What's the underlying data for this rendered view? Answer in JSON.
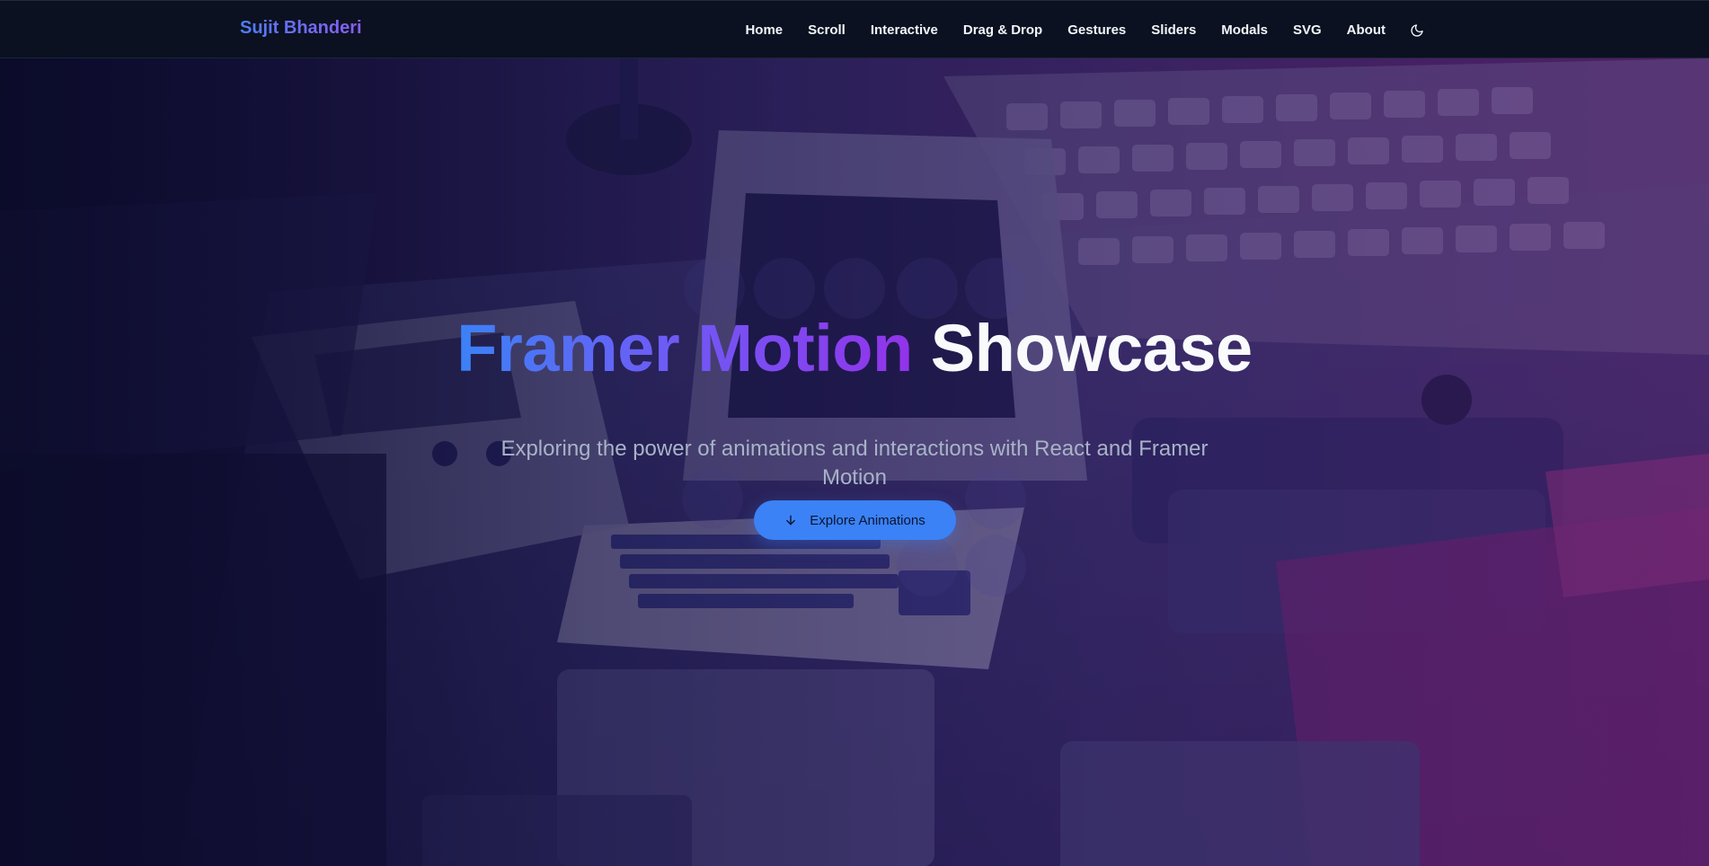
{
  "header": {
    "brand": "Sujit Bhanderi",
    "nav": [
      "Home",
      "Scroll",
      "Interactive",
      "Drag & Drop",
      "Gestures",
      "Sliders",
      "Modals",
      "SVG",
      "About"
    ],
    "theme_icon": "moon-icon"
  },
  "hero": {
    "title_gradient": "Framer Motion",
    "title_plain": "Showcase",
    "subtitle": "Exploring the power of animations and interactions with React and Framer Motion",
    "cta_label": "Explore Animations",
    "cta_icon": "arrow-down-icon"
  },
  "colors": {
    "accent": "#3b82f6",
    "purple": "#9333ea",
    "header_bg": "#0b1120"
  }
}
